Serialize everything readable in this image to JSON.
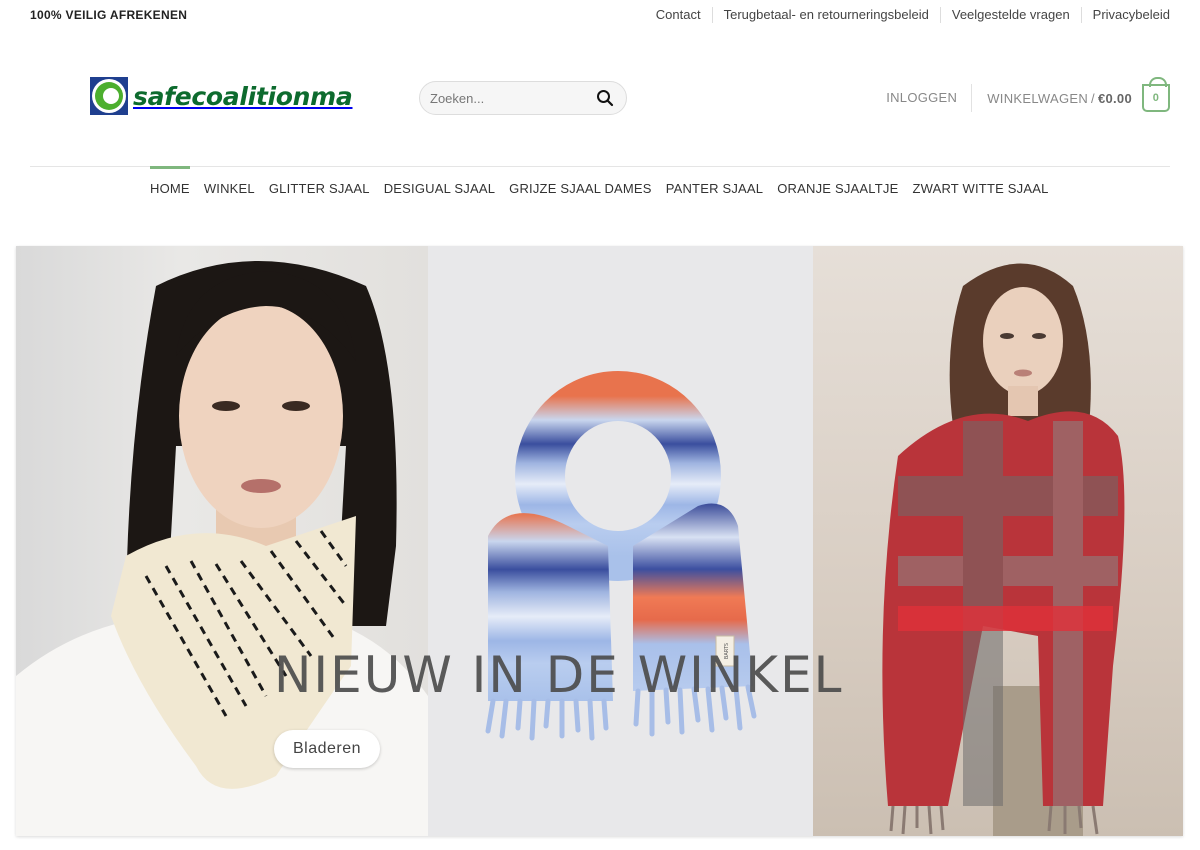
{
  "topbar": {
    "secure_checkout": "100% VEILIG AFREKENEN",
    "links": [
      "Contact",
      "Terugbetaal- en retourneringsbeleid",
      "Veelgestelde vragen",
      "Privacybeleid"
    ]
  },
  "header": {
    "logo_text": "safecoalitionma",
    "search_placeholder": "Zoeken...",
    "login": "INLOGGEN",
    "cart_label": "WINKELWAGEN",
    "cart_separator": "/",
    "cart_total": "€0.00",
    "cart_count": "0"
  },
  "nav": {
    "items": [
      "HOME",
      "WINKEL",
      "GLITTER SJAAL",
      "DESIGUAL SJAAL",
      "GRIJZE SJAAL DAMES",
      "PANTER SJAAL",
      "ORANJE SJAALTJE",
      "ZWART WITTE SJAAL"
    ],
    "active": "HOME"
  },
  "hero": {
    "title": "NIEUW IN DE WINKEL",
    "button": "Bladeren",
    "scarf_tag": "BARTS"
  },
  "colors": {
    "accent": "#7fb77e",
    "logo_green": "#0d6b2e",
    "logo_blue": "#1f3f8f"
  },
  "icons": {
    "search": "search-icon",
    "cart": "cart-bag-icon",
    "logo": "logo-mark-icon"
  }
}
